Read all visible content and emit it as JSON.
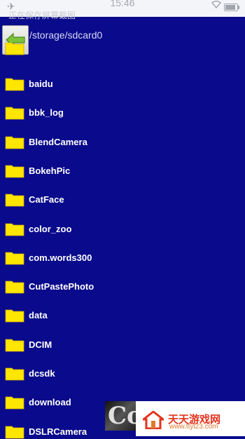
{
  "status_bar": {
    "time": "15:46",
    "notice": "正在保存屏幕截图",
    "airplane_icon": "airplane-icon",
    "wifi_icon": "wifi-icon",
    "battery_icon": "battery-icon"
  },
  "path_bar": {
    "path": "/storage/sdcard0",
    "up_icon": "arrow-left-icon"
  },
  "files": [
    {
      "name": "baidu"
    },
    {
      "name": "bbk_log"
    },
    {
      "name": "BlendCamera"
    },
    {
      "name": "BokehPic"
    },
    {
      "name": "CatFace"
    },
    {
      "name": "color_zoo"
    },
    {
      "name": "com.words300"
    },
    {
      "name": "CutPastePhoto"
    },
    {
      "name": "data"
    },
    {
      "name": "DCIM"
    },
    {
      "name": "dcsdk"
    },
    {
      "name": "download"
    },
    {
      "name": "DSLRCamera"
    }
  ],
  "watermark": {
    "title": "天天游戏网",
    "url": "www.ttyl23.com",
    "left_letters": "Co"
  },
  "colors": {
    "background": "#0A0A8C",
    "folder": "#FFE600",
    "text": "#FFFFFF"
  }
}
